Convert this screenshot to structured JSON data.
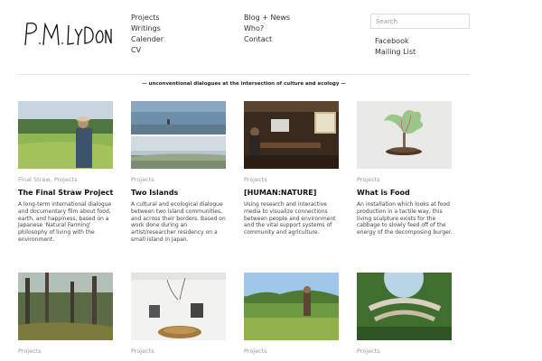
{
  "logo": {
    "text": "P.M. LYDON"
  },
  "nav": {
    "col1": [
      "Projects",
      "Writings",
      "Calender",
      "CV"
    ],
    "col2": [
      "Blog + News",
      "Who?",
      "Contact"
    ],
    "col3": [
      "Facebook",
      "Mailing List"
    ]
  },
  "search": {
    "placeholder": "Search"
  },
  "tagline": "— unconventional dialogues at the intersection of culture and ecology —",
  "cards": [
    {
      "category": "Final Straw, Projects",
      "title": "The Final Straw Project",
      "description": "A long-term international dialogue and documentary film about food, earth, and happiness, based on a Japanese 'Natural Farming' philosophy of living with the environment."
    },
    {
      "category": "Projects",
      "title": "Two Islands",
      "description": "A cultural and ecological dialogue between two island communities, and across their borders. Based on work done during an artist/researcher residency on a small island in Japan."
    },
    {
      "category": "Projects",
      "title": "[HUMAN:NATURE]",
      "description": "Using research and interactive media to visualize connections between people and environment and the vital support systems of community and agriculture."
    },
    {
      "category": "Projects",
      "title": "What is Food",
      "description": "An installation which looks at food production in a tactile way, this living sculpture exists for the cabbage to slowly feed off of the energy of the decomposing burger."
    },
    {
      "category": "Projects",
      "title": "",
      "description": ""
    },
    {
      "category": "Projects",
      "title": "",
      "description": ""
    },
    {
      "category": "Projects",
      "title": "",
      "description": ""
    },
    {
      "category": "Projects",
      "title": "",
      "description": ""
    }
  ]
}
